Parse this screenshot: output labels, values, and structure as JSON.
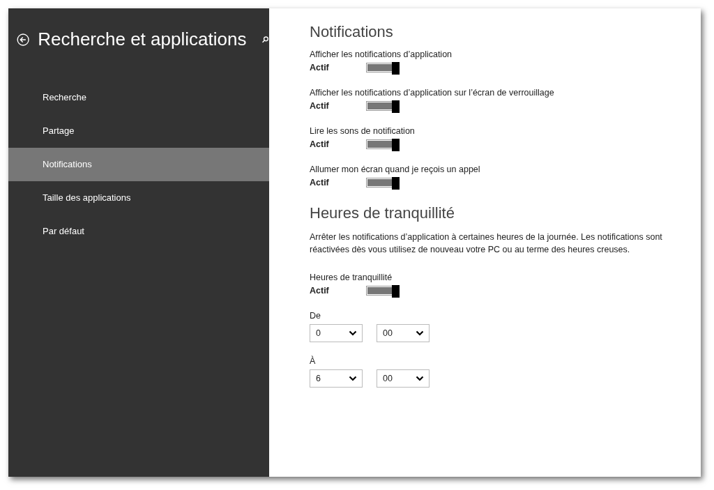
{
  "sidebar": {
    "title": "Recherche et applications",
    "items": [
      {
        "label": "Recherche",
        "selected": false
      },
      {
        "label": "Partage",
        "selected": false
      },
      {
        "label": "Notifications",
        "selected": true
      },
      {
        "label": "Taille des applications",
        "selected": false
      },
      {
        "label": "Par défaut",
        "selected": false
      }
    ]
  },
  "sections": [
    {
      "heading": "Notifications",
      "settings": [
        {
          "kind": "toggle",
          "label": "Afficher les notifications d’application",
          "state_label": "Actif",
          "on": true
        },
        {
          "kind": "toggle",
          "label": "Afficher les notifications d’application sur l’écran de verrouillage",
          "state_label": "Actif",
          "on": true
        },
        {
          "kind": "toggle",
          "label": "Lire les sons de notification",
          "state_label": "Actif",
          "on": true
        },
        {
          "kind": "toggle",
          "label": "Allumer mon écran quand je reçois un appel",
          "state_label": "Actif",
          "on": true
        }
      ]
    },
    {
      "heading": "Heures de tranquillité",
      "settings": [
        {
          "kind": "text",
          "text": "Arrêter les notifications d’application à certaines heures de la journée. Les notifications sont réactivées dès vous utilisez de nouveau votre PC ou au terme des heures creuses."
        },
        {
          "kind": "toggle",
          "label": "Heures de tranquillité",
          "state_label": "Actif",
          "on": true
        },
        {
          "kind": "time",
          "label": "De",
          "hour": "0",
          "minute": "00"
        },
        {
          "kind": "time",
          "label": "À",
          "hour": "6",
          "minute": "00"
        }
      ]
    }
  ]
}
